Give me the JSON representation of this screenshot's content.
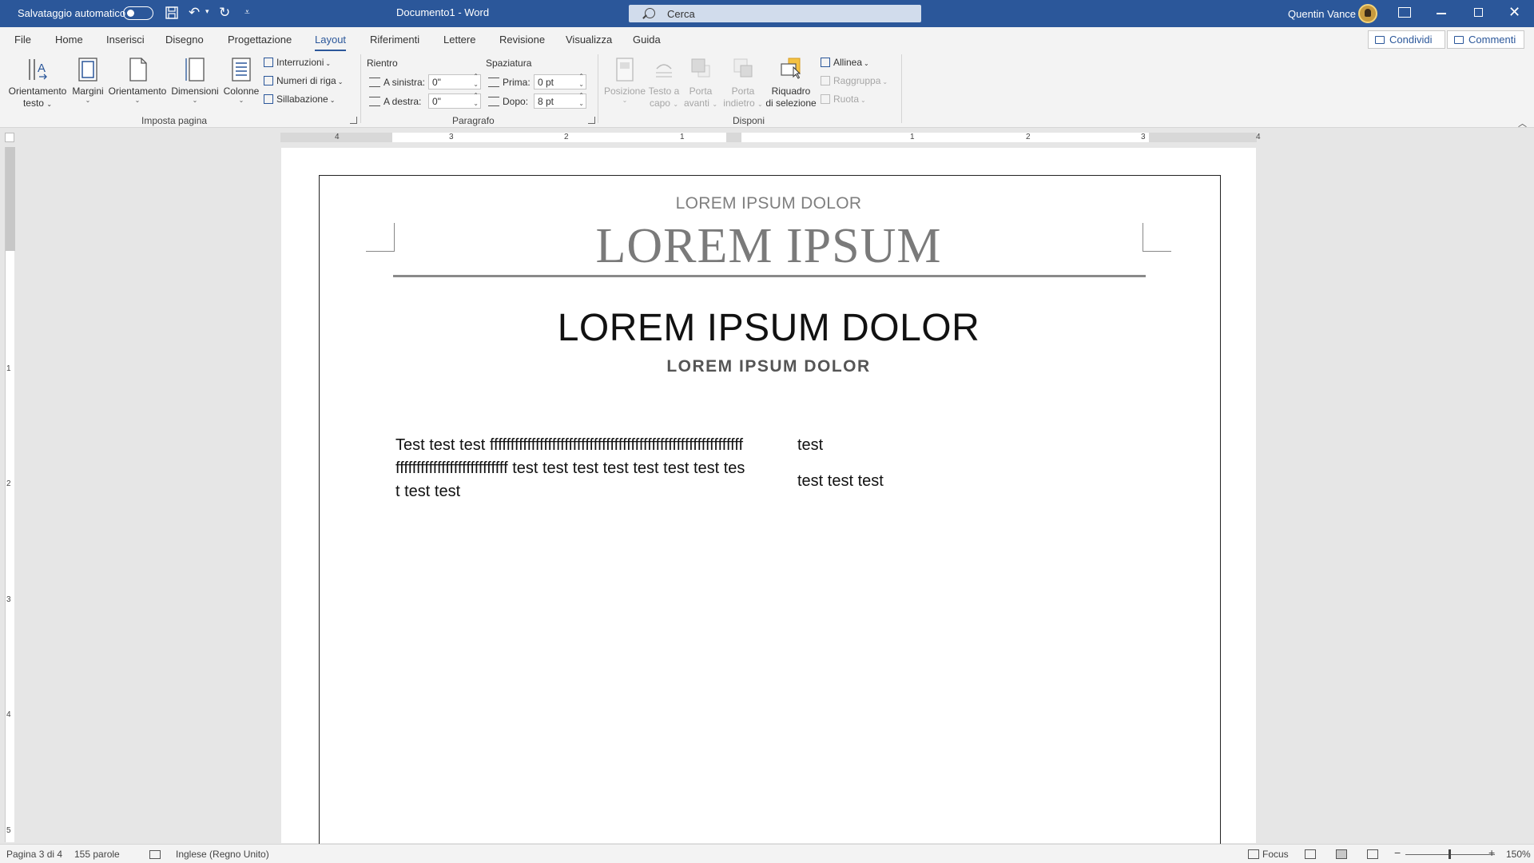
{
  "titlebar": {
    "autosave_label": "Salvataggio automatico",
    "document_title": "Documento1  -  Word",
    "search_placeholder": "Cerca",
    "user_name": "Quentin Vance",
    "accent_color": "#2b579a"
  },
  "tabs": [
    "File",
    "Home",
    "Inserisci",
    "Disegno",
    "Progettazione",
    "Layout",
    "Riferimenti",
    "Lettere",
    "Revisione",
    "Visualizza",
    "Guida"
  ],
  "active_tab": "Layout",
  "share_label": "Condividi",
  "comments_label": "Commenti",
  "ribbon": {
    "page_setup": {
      "label": "Imposta pagina",
      "text_direction": [
        "Orientamento",
        "testo"
      ],
      "margins": "Margini",
      "orientation": "Orientamento",
      "size": "Dimensioni",
      "columns": "Colonne",
      "breaks": "Interruzioni",
      "line_numbers": "Numeri di riga",
      "hyphenation": "Sillabazione"
    },
    "paragraph": {
      "label": "Paragrafo",
      "indent_label": "Rientro",
      "spacing_label": "Spaziatura",
      "left_label": "A sinistra:",
      "left_value": "0\"",
      "right_label": "A destra:",
      "right_value": "0\"",
      "before_label": "Prima:",
      "before_value": "0 pt",
      "after_label": "Dopo:",
      "after_value": "8 pt"
    },
    "arrange": {
      "label": "Disponi",
      "position": "Posizione",
      "wrap_text": [
        "Testo a",
        "capo"
      ],
      "bring_forward": [
        "Porta",
        "avanti"
      ],
      "send_backward": [
        "Porta",
        "indietro"
      ],
      "selection_pane": [
        "Riquadro",
        "di selezione"
      ],
      "align": "Allinea",
      "group": "Raggruppa",
      "rotate": "Ruota"
    }
  },
  "ruler": {
    "h_numbers": [
      "4",
      "3",
      "2",
      "1",
      "1",
      "2",
      "3",
      "4"
    ],
    "v_numbers": [
      "1",
      "2",
      "3",
      "4",
      "5"
    ]
  },
  "document": {
    "kicker": "LOREM IPSUM DOLOR",
    "title": "LOREM IPSUM",
    "heading1": "LOREM IPSUM DOLOR",
    "heading2": "LOREM IPSUM DOLOR",
    "left_column": "Test test test ffffffffffffffffffffffffffffffffffffffffffffffffffffffffffffffffffffffffffffffffffffffff test test test test test test test test test test",
    "right_column": [
      "test",
      "test test test"
    ]
  },
  "statusbar": {
    "page": "Pagina 3 di 4",
    "words": "155 parole",
    "language": "Inglese (Regno Unito)",
    "focus": "Focus",
    "zoom": "150%",
    "zoom_minus": "−",
    "zoom_plus": "+"
  }
}
